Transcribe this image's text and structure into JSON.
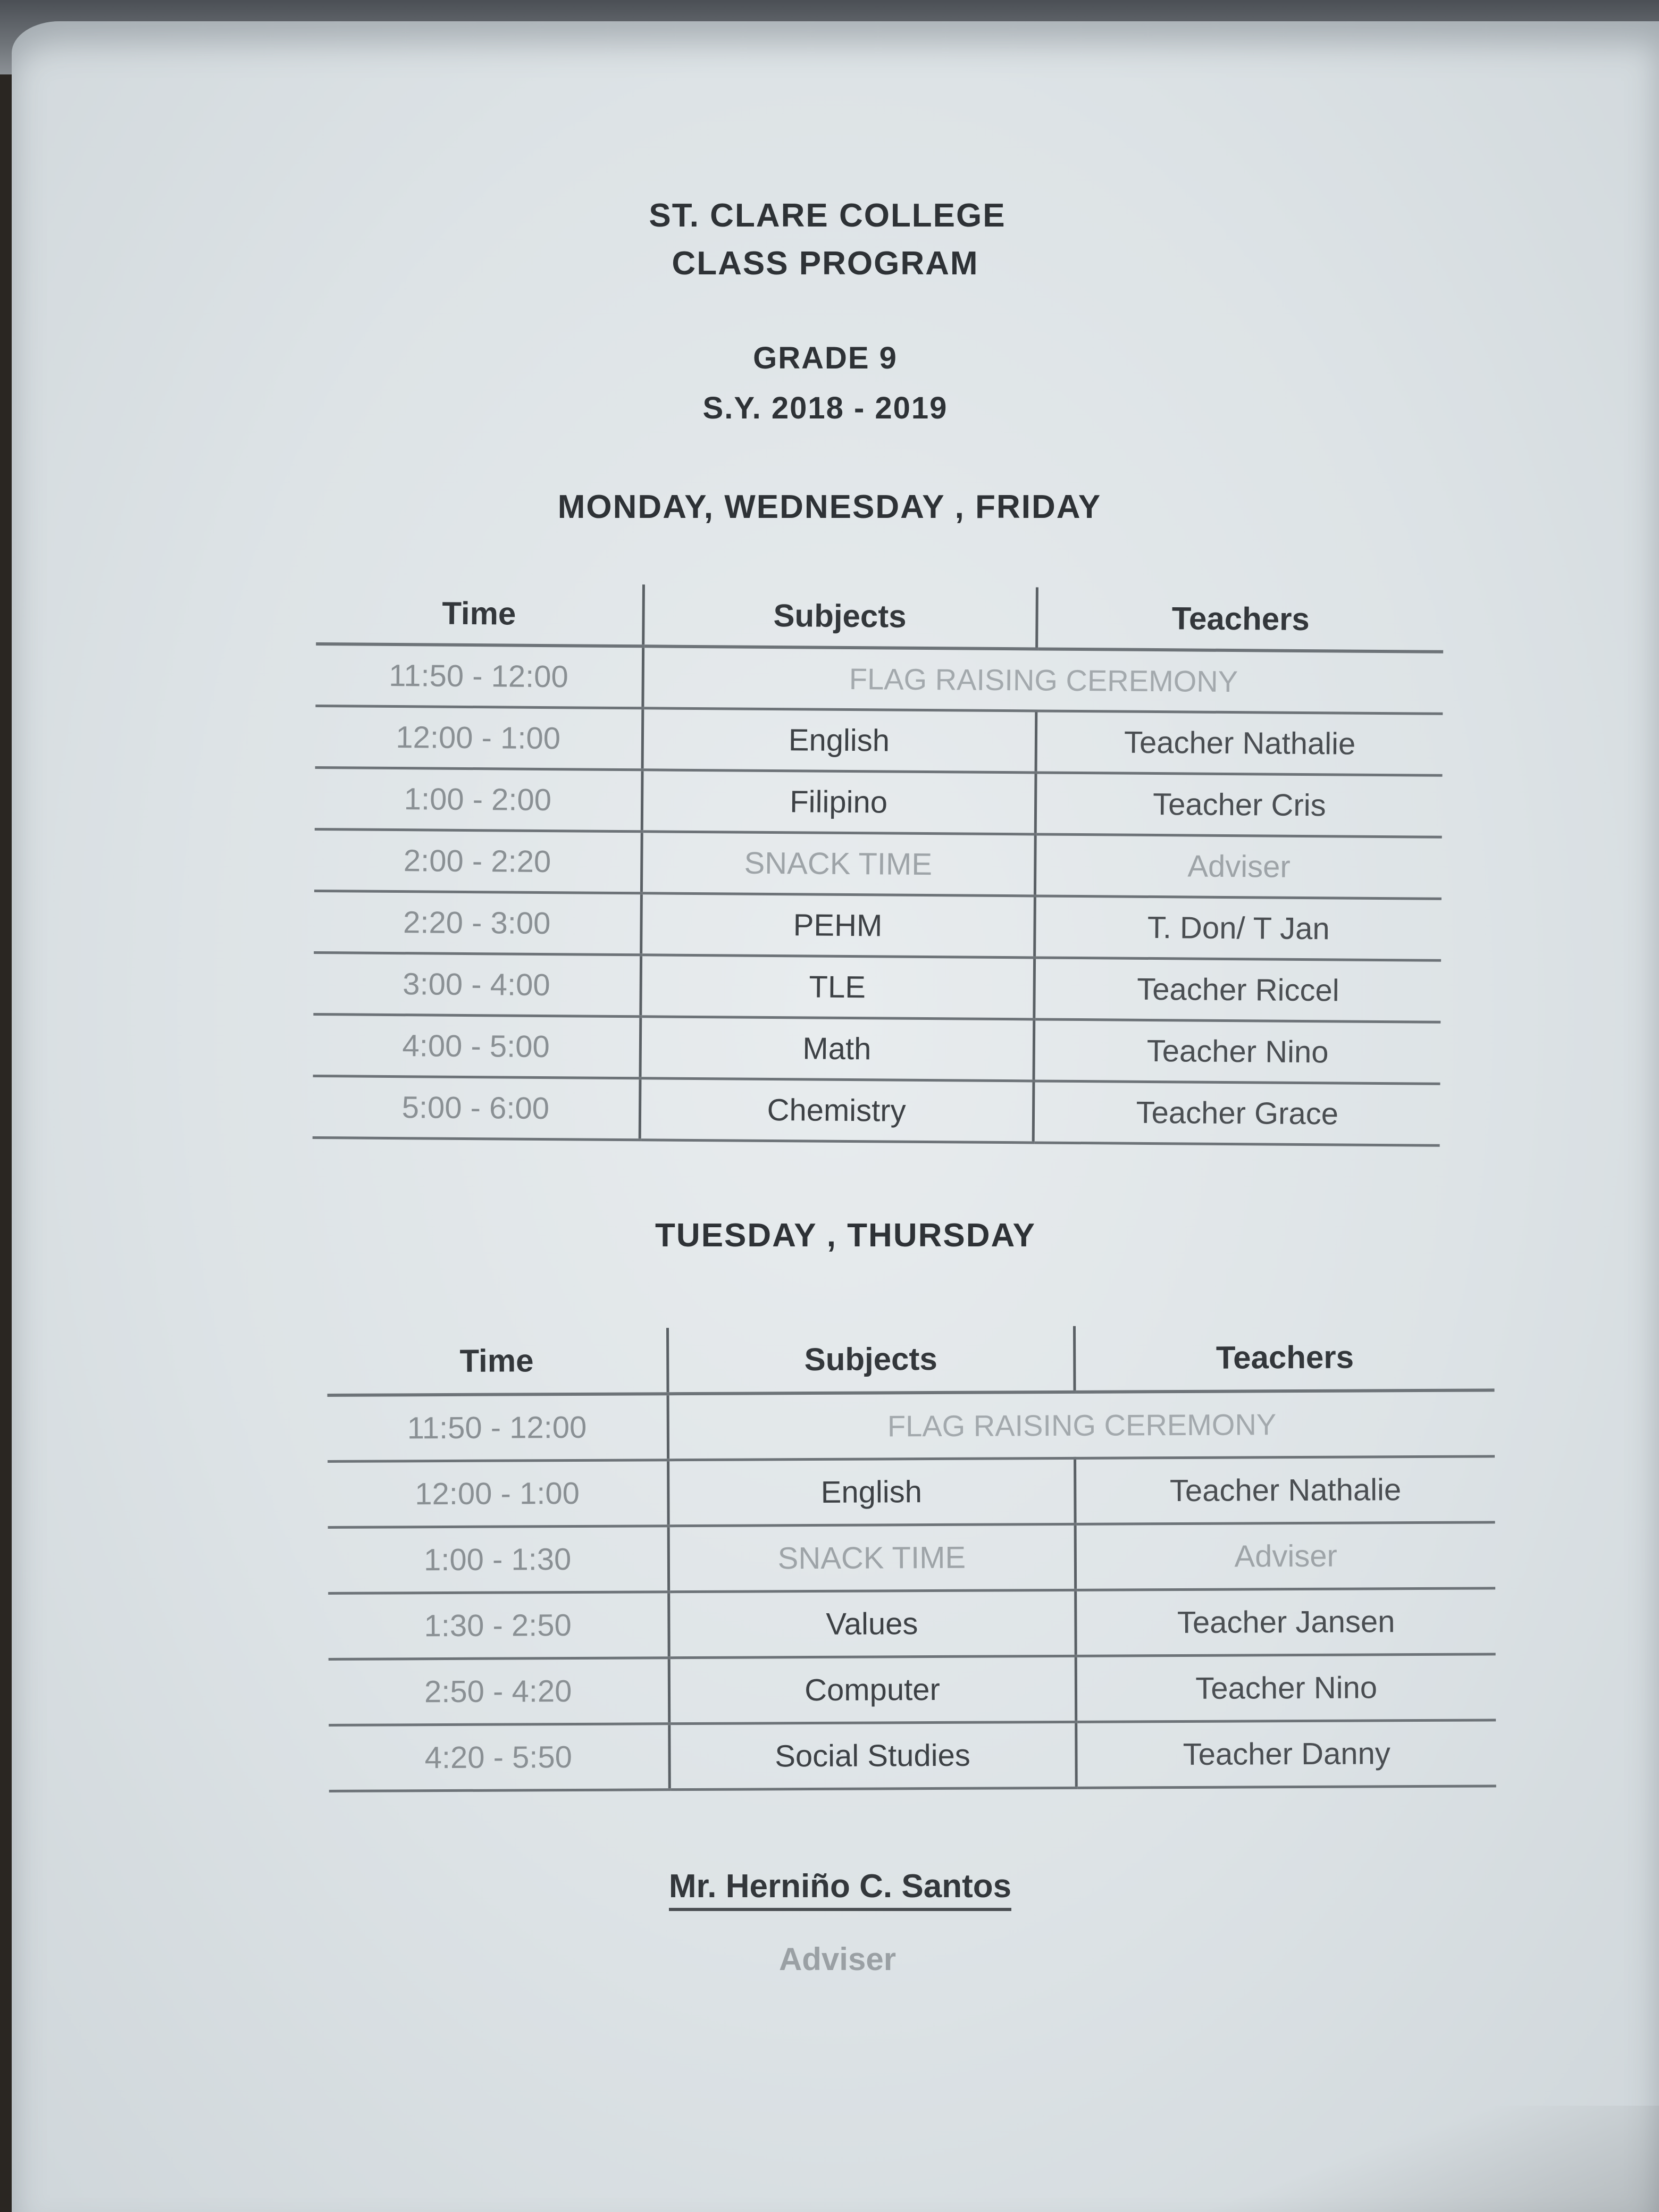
{
  "header": {
    "school": "ST. CLARE COLLEGE",
    "doc_title": "CLASS PROGRAM",
    "grade": "GRADE 9",
    "school_year": "S.Y. 2018 - 2019"
  },
  "schedule_mwf": {
    "day_label": "MONDAY, WEDNESDAY , FRIDAY",
    "columns": [
      "Time",
      "Subjects",
      "Teachers"
    ],
    "span_row": {
      "time": "11:50 - 12:00",
      "text": "FLAG RAISING CEREMONY"
    },
    "rows": [
      {
        "time": "12:00 - 1:00",
        "subject": "English",
        "teacher": "Teacher Nathalie"
      },
      {
        "time": "1:00 - 2:00",
        "subject": "Filipino",
        "teacher": "Teacher Cris"
      },
      {
        "time": "2:00 - 2:20",
        "subject": "SNACK TIME",
        "teacher": "Adviser"
      },
      {
        "time": "2:20 - 3:00",
        "subject": "PEHM",
        "teacher": "T. Don/ T Jan"
      },
      {
        "time": "3:00 - 4:00",
        "subject": "TLE",
        "teacher": "Teacher Riccel"
      },
      {
        "time": "4:00 - 5:00",
        "subject": "Math",
        "teacher": "Teacher Nino"
      },
      {
        "time": "5:00 - 6:00",
        "subject": "Chemistry",
        "teacher": "Teacher Grace"
      }
    ]
  },
  "schedule_tth": {
    "day_label": "TUESDAY , THURSDAY",
    "columns": [
      "Time",
      "Subjects",
      "Teachers"
    ],
    "span_row": {
      "time": "11:50 - 12:00",
      "text": "FLAG RAISING CEREMONY"
    },
    "rows": [
      {
        "time": "12:00 - 1:00",
        "subject": "English",
        "teacher": "Teacher Nathalie"
      },
      {
        "time": "1:00 - 1:30",
        "subject": "SNACK TIME",
        "teacher": "Adviser"
      },
      {
        "time": "1:30 - 2:50",
        "subject": "Values",
        "teacher": "Teacher Jansen"
      },
      {
        "time": "2:50 - 4:20",
        "subject": "Computer",
        "teacher": "Teacher Nino"
      },
      {
        "time": "4:20 - 5:50",
        "subject": "Social Studies",
        "teacher": "Teacher Danny"
      }
    ]
  },
  "signature": {
    "name": "Mr. Herniño C. Santos",
    "role": "Adviser"
  }
}
